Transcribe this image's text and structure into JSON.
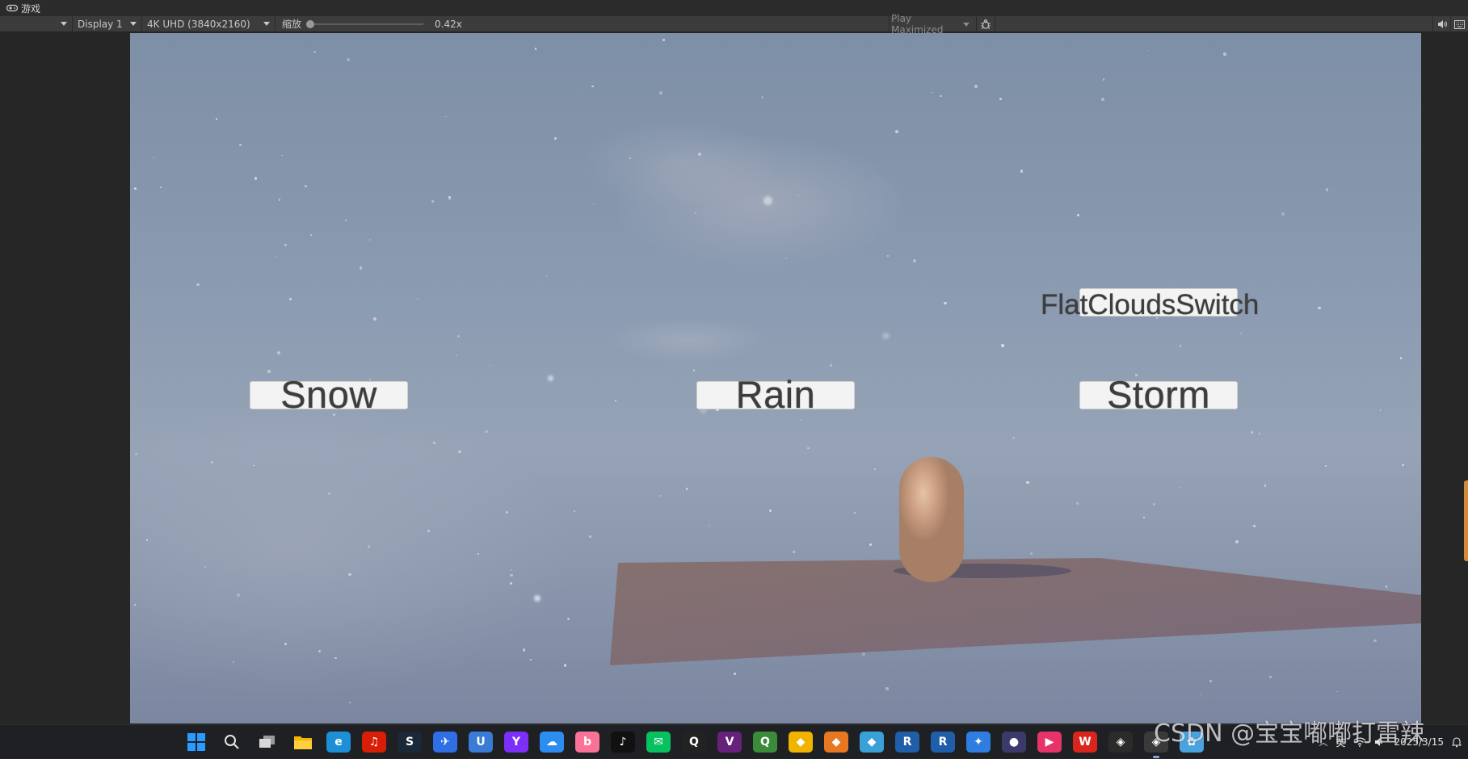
{
  "window": {
    "title": "游戏",
    "title_icon": "gamepad-icon"
  },
  "toolbar": {
    "game_view_mode": "",
    "display": "Display 1",
    "resolution": "4K UHD (3840x2160)",
    "scale_label": "缩放",
    "scale_value": "0.42x",
    "scale_fraction": 0.0,
    "play_mode": "Play Maximized",
    "stats_icon": "bug-icon",
    "mute_icon": "speaker-icon",
    "stats_toggle_icon": "keyboard-icon"
  },
  "game": {
    "buttons": {
      "snow": "Snow",
      "rain": "Rain",
      "storm": "Storm"
    },
    "flat_clouds_label": "FlatCloudsSwitch",
    "colors": {
      "sky": "#8a9ab0",
      "ground": "#7e6e72",
      "capsule": "#cfa285",
      "button_bg": "#f3f3f3"
    }
  },
  "taskbar": {
    "apps": [
      {
        "name": "windows-start",
        "glyph": "",
        "color": "#2a8cff"
      },
      {
        "name": "search",
        "glyph": "",
        "color": "#1f2024"
      },
      {
        "name": "task-view",
        "glyph": "",
        "color": "#1f2024"
      },
      {
        "name": "file-explorer",
        "glyph": "",
        "color": "#f4b400"
      },
      {
        "name": "edge",
        "glyph": "e",
        "color": "#1c8fd6"
      },
      {
        "name": "netease-music",
        "glyph": "♫",
        "color": "#d81e06"
      },
      {
        "name": "steam",
        "glyph": "S",
        "color": "#1b2838"
      },
      {
        "name": "feishu",
        "glyph": "✈",
        "color": "#2f6fe6"
      },
      {
        "name": "app-u",
        "glyph": "U",
        "color": "#3a7bd5"
      },
      {
        "name": "app-y",
        "glyph": "Y",
        "color": "#7b2ff7"
      },
      {
        "name": "baidu-netdisk",
        "glyph": "☁",
        "color": "#2d8cf0"
      },
      {
        "name": "bilibili",
        "glyph": "b",
        "color": "#fb7299"
      },
      {
        "name": "tiktok",
        "glyph": "♪",
        "color": "#111111"
      },
      {
        "name": "wechat",
        "glyph": "✉",
        "color": "#07c160"
      },
      {
        "name": "qq",
        "glyph": "Q",
        "color": "#222222"
      },
      {
        "name": "visual-studio",
        "glyph": "V",
        "color": "#68217a"
      },
      {
        "name": "qgis",
        "glyph": "Q",
        "color": "#3a8b3a"
      },
      {
        "name": "app-yellow",
        "glyph": "◆",
        "color": "#f0b400"
      },
      {
        "name": "app-orange",
        "glyph": "◆",
        "color": "#e87722"
      },
      {
        "name": "app-cyan",
        "glyph": "◆",
        "color": "#3aa0d8"
      },
      {
        "name": "revit-1",
        "glyph": "R",
        "color": "#1f5ea8"
      },
      {
        "name": "revit-2",
        "glyph": "R",
        "color": "#1f5ea8"
      },
      {
        "name": "app-bird",
        "glyph": "✦",
        "color": "#2f7de1"
      },
      {
        "name": "app-cat",
        "glyph": "●",
        "color": "#3b3b6b"
      },
      {
        "name": "app-pink",
        "glyph": "▶",
        "color": "#e6346b"
      },
      {
        "name": "wps",
        "glyph": "W",
        "color": "#d9261c"
      },
      {
        "name": "unity-hub",
        "glyph": "◈",
        "color": "#2b2b2b"
      },
      {
        "name": "unity-editor",
        "glyph": "◈",
        "color": "#3a3a3a"
      },
      {
        "name": "app-net",
        "glyph": "✿",
        "color": "#4aa3df"
      }
    ],
    "tray_lang": "英",
    "date": "2025/3/15",
    "time": ""
  },
  "watermark": "CSDN @宝宝嘟嘟打雷辣"
}
